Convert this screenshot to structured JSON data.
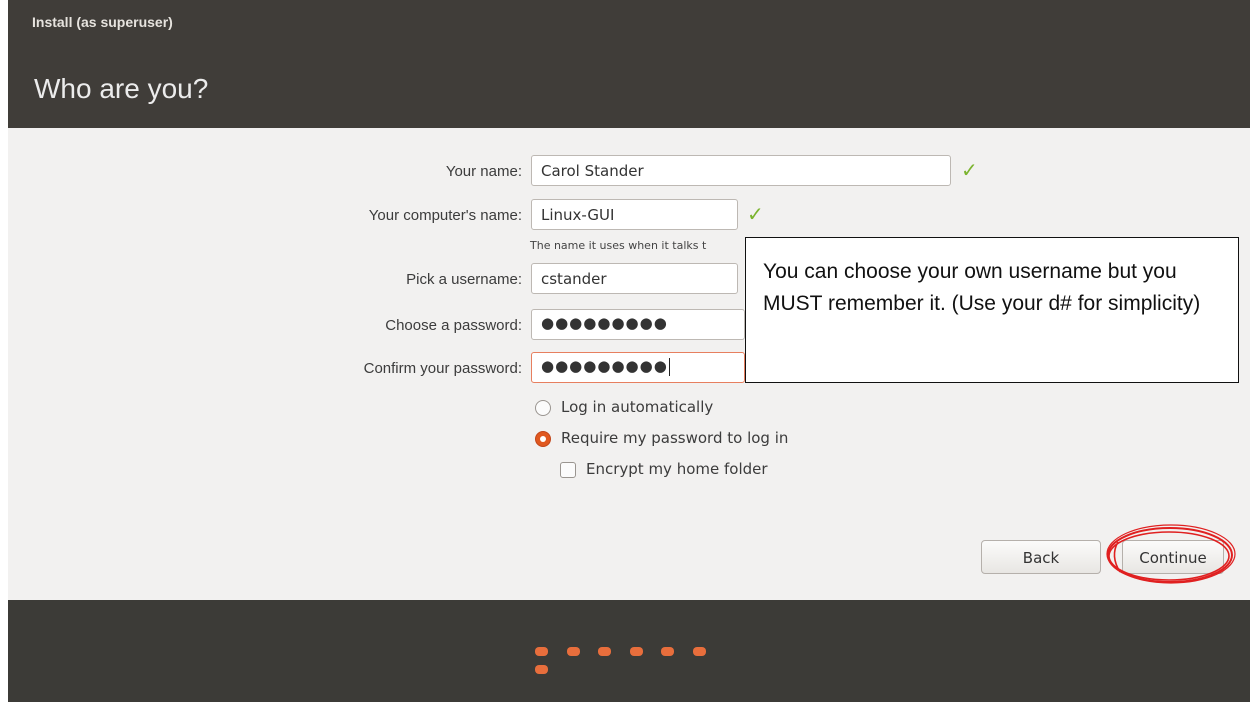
{
  "window": {
    "title": "Install (as superuser)"
  },
  "header": {
    "title": "Who are you?"
  },
  "form": {
    "name": {
      "label": "Your name:",
      "value": "Carol Stander"
    },
    "computer": {
      "label": "Your computer's name:",
      "value": "Linux-GUI",
      "hint": "The name it uses when it talks t"
    },
    "username": {
      "label": "Pick a username:",
      "value": "cstander"
    },
    "password": {
      "label": "Choose a password:",
      "value": "●●●●●●●●●"
    },
    "confirm": {
      "label": "Confirm your password:",
      "value": "●●●●●●●●●"
    }
  },
  "options": {
    "auto_login": {
      "label": "Log in automatically",
      "selected": false
    },
    "require_password": {
      "label": "Require my password to log in",
      "selected": true
    },
    "encrypt_home": {
      "label": "Encrypt my home folder",
      "checked": false
    }
  },
  "buttons": {
    "back": "Back",
    "continue": "Continue"
  },
  "annotation": {
    "callout_text": "You can choose your own username but you MUST remember it. (Use your d# for simplicity)",
    "highlight_color": "#e02020"
  },
  "progress": {
    "total_steps": 7
  },
  "colors": {
    "accent": "#e0581f",
    "check": "#7bb32e",
    "chrome": "#403d39"
  }
}
